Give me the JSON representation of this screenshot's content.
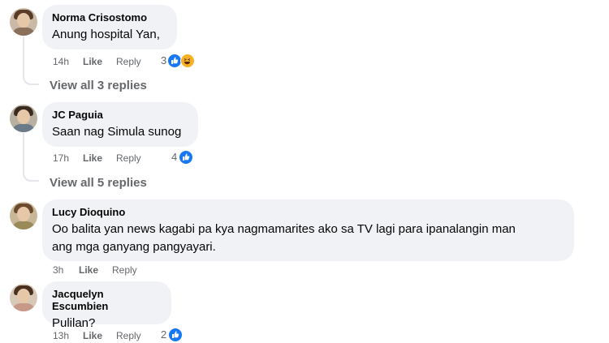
{
  "comments": [
    {
      "author": "Norma Crisostomo",
      "text": "Anung hospital Yan,",
      "time": "14h",
      "like_label": "Like",
      "reply_label": "Reply",
      "reaction_count": "3",
      "reactions": [
        "like-icon",
        "haha-icon"
      ],
      "view_replies": "View all 3 replies"
    },
    {
      "author": "JC Paguia",
      "text": "Saan nag Simula sunog",
      "time": "17h",
      "like_label": "Like",
      "reply_label": "Reply",
      "reaction_count": "4",
      "reactions": [
        "like-icon"
      ],
      "view_replies": "View all 5 replies"
    },
    {
      "author": "Lucy Dioquino",
      "text_lines": [
        "Oo balita yan news kagabi pa kya nagmamarites ako sa TV lagi para ipanalangin man",
        "ang mga ganyang pangyayari."
      ],
      "time": "3h",
      "like_label": "Like",
      "reply_label": "Reply"
    },
    {
      "author": "Jacquelyn Escumbien",
      "text": "Pulilan?",
      "time": "13h",
      "like_label": "Like",
      "reply_label": "Reply",
      "reaction_count": "2",
      "reactions": [
        "like-icon"
      ]
    }
  ],
  "colors": {
    "bubble": "#f0f2f5",
    "meta_text": "#65676b",
    "like_blue": "#1877f2",
    "haha_yellow": "#f7b125",
    "thread_line": "#e4e6eb"
  }
}
